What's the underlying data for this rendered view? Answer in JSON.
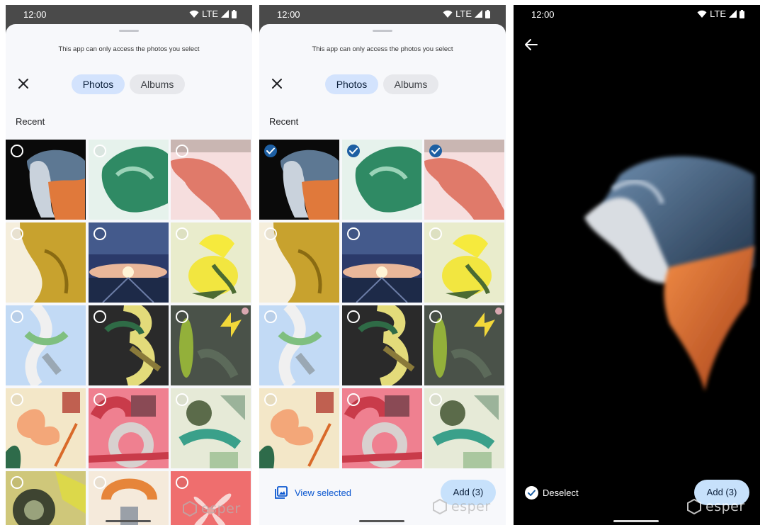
{
  "status_bar": {
    "time": "12:00",
    "network": "LTE"
  },
  "picker": {
    "notice": "This app can only access the photos you select",
    "tabs": [
      "Photos",
      "Albums"
    ],
    "section_title": "Recent"
  },
  "panel2": {
    "view_selected_label": "View selected",
    "add_label": "Add (3)",
    "selected_count": 3
  },
  "viewer": {
    "deselect_label": "Deselect",
    "add_label": "Add (3)"
  },
  "watermark": "esper",
  "colors": {
    "accent": "#0b57d0",
    "selected_check": "#1d5fa3",
    "chip_active": "#d3e3fd",
    "add_button": "#c7e1fb"
  },
  "icons": {
    "close": "close-icon",
    "back": "arrow-back-icon",
    "check": "check-circle-icon",
    "gallery": "gallery-icon",
    "wifi": "wifi-icon",
    "signal": "signal-icon",
    "battery": "battery-icon"
  }
}
